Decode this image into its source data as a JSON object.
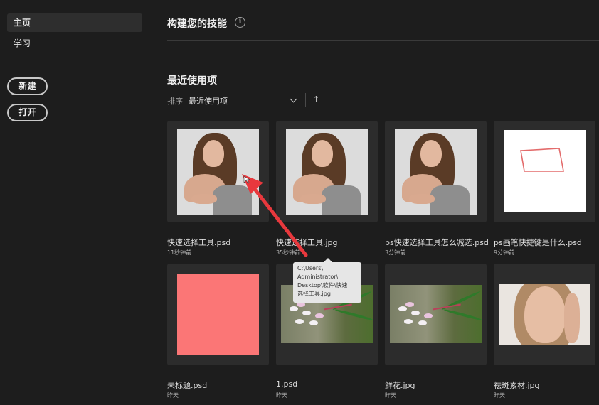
{
  "sidebar": {
    "items": [
      {
        "label": "主页",
        "active": true
      },
      {
        "label": "学习",
        "active": false
      }
    ],
    "new_button": "新建",
    "open_button": "打开"
  },
  "header": {
    "title": "构建您的技能",
    "info_icon": "info-icon"
  },
  "recent": {
    "title": "最近使用项",
    "sort_label": "排序",
    "sort_value": "最近使用项",
    "sort_direction": "↑"
  },
  "files": [
    {
      "name": "快速选择工具.psd",
      "time": "11秒钟前"
    },
    {
      "name": "快速选择工具.jpg",
      "time": "35秒钟前"
    },
    {
      "name": "ps快速选择工具怎么减选.psd",
      "time": "3分钟前"
    },
    {
      "name": "ps画笔快捷键是什么.psd",
      "time": "9分钟前"
    },
    {
      "name": "未标题.psd",
      "time": "昨天"
    },
    {
      "name": "1.psd",
      "time": "昨天"
    },
    {
      "name": "鲜花.jpg",
      "time": "昨天"
    },
    {
      "name": "祛斑素材.jpg",
      "time": "昨天"
    }
  ],
  "tooltip": {
    "lines": [
      "C:\\Users\\",
      "Administrator\\",
      "Desktop\\软件\\快速",
      "选择工具.jpg"
    ]
  },
  "colors": {
    "background": "#1d1d1d",
    "card": "#2c2c2c",
    "pink_canvas": "#fb7676",
    "annotation": "#e8383d"
  }
}
